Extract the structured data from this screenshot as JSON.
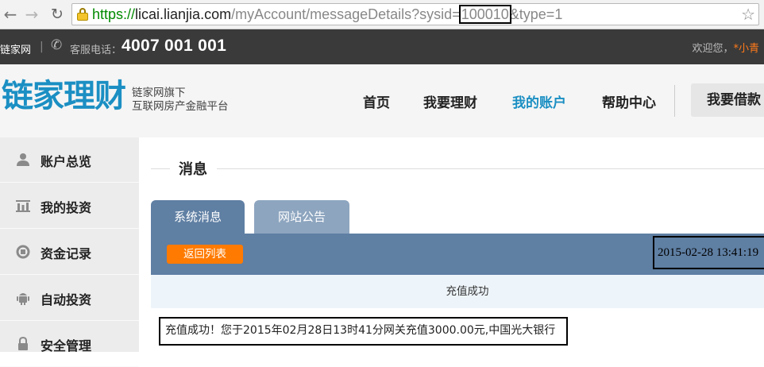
{
  "browser": {
    "url_scheme": "https://",
    "url_host": "licai.lianjia.com",
    "url_path_before": "/myAccount/messageDetails?sysid=",
    "url_sysid": "100010",
    "url_path_after": "&type=1"
  },
  "topbar": {
    "site_name": "链家网",
    "separator": "|",
    "service_label": "客服电话：",
    "service_phone": "4007 001 001",
    "welcome_prefix": "欢迎您，",
    "username": "*小青"
  },
  "header": {
    "logo_text": "链家理财",
    "logo_sub_line1": "链家网旗下",
    "logo_sub_line2": "互联网房产金融平台",
    "nav": [
      {
        "label": "首页"
      },
      {
        "label": "我要理财"
      },
      {
        "label": "我的账户"
      },
      {
        "label": "帮助中心"
      }
    ],
    "borrow_label": "我要借款"
  },
  "sidebar": {
    "items": [
      {
        "label": "账户总览",
        "icon": "user-icon"
      },
      {
        "label": "我的投资",
        "icon": "chart-icon"
      },
      {
        "label": "资金记录",
        "icon": "ledger-icon"
      },
      {
        "label": "自动投资",
        "icon": "robot-icon"
      },
      {
        "label": "安全管理",
        "icon": "lock-icon"
      }
    ]
  },
  "main": {
    "title": "消息",
    "tabs": [
      {
        "label": "系统消息",
        "active": true
      },
      {
        "label": "网站公告",
        "active": false
      }
    ],
    "back_label": "返回列表",
    "message_time": "2015-02-28 13:41:19",
    "message_subject": "充值成功",
    "message_body": "充值成功！您于2015年02月28日13时41分网关充值3000.00元,中国光大银行"
  },
  "colors": {
    "brand": "#1b8fc3",
    "accent": "#ff7a00",
    "tab_active": "#5f7fa3",
    "tab_inactive": "#8da5bf"
  }
}
